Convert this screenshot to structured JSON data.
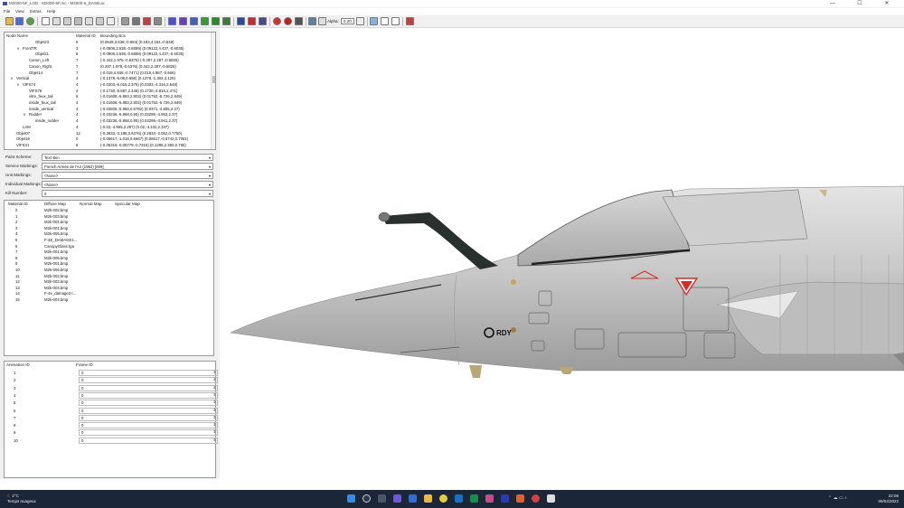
{
  "window": {
    "title": "M2000-5F_LOD - M2000-5F.mc - M2000-5_DASB.ac",
    "minimize": "—",
    "maximize": "☐",
    "close": "✕"
  },
  "menu": [
    "File",
    "View",
    "Extras",
    "Help"
  ],
  "toolbar": {
    "alpha_label": "Alpha:",
    "alpha_value": "0.20"
  },
  "node_tree": {
    "columns": [
      "Node Name",
      "Material ID",
      "Bounding Box"
    ],
    "rows": [
      {
        "indent": 4,
        "toggle": "",
        "name": "Objet23",
        "mat": "8",
        "bbox": "(0.0648,3.538,-0.684) (0.184,4.164,-0.648)"
      },
      {
        "indent": 2,
        "toggle": "v",
        "name": "FrontTR",
        "mat": "3",
        "bbox": "(-0.0906,3.538,-0.6889) (0.09122,4.437,-0.6035)"
      },
      {
        "indent": 4,
        "toggle": "",
        "name": "Objet21",
        "mat": "8",
        "bbox": "(-0.0906,3.538,-0.6889) (0.09122,4.437,-0.6035)"
      },
      {
        "indent": 3,
        "toggle": "",
        "name": "Canon_Left",
        "mat": "7",
        "bbox": "(-0.342,1.978,-0.6376) (-0.287,2.287,-0.5826)"
      },
      {
        "indent": 3,
        "toggle": "",
        "name": "Canon_Right",
        "mat": "7",
        "bbox": "(0.287,1.978,-0.6376) (0.342,2.287,-0.5826)"
      },
      {
        "indent": 3,
        "toggle": "",
        "name": "Objet14",
        "mat": "7",
        "bbox": "(-0.015,4.848,-0.7471) (0.015,4.987,-0.666)"
      },
      {
        "indent": 1,
        "toggle": "v",
        "name": "Vertical",
        "mat": "4",
        "bbox": "(-0.1378,-6.08,0.658) (0.1378,-1.302,3.129)"
      },
      {
        "indent": 2,
        "toggle": "v",
        "name": "VIFS74",
        "mat": "4",
        "bbox": "(-0.0303,-6.015,2.376) (0.0303,-4.316,2.548)"
      },
      {
        "indent": 3,
        "toggle": "",
        "name": "VIFS78",
        "mat": "4",
        "bbox": "(-0.1730,-5.587,2.448) (0.1730,-4.816,2.471)"
      },
      {
        "indent": 3,
        "toggle": "",
        "name": "vitre_feux_tail",
        "mat": "6",
        "bbox": "(-0.01608,-5.883,2.803) (0.01752,-5.726,2.849)"
      },
      {
        "indent": 3,
        "toggle": "",
        "name": "inside_feux_tail",
        "mat": "4",
        "bbox": "(-0.01608,-5.883,2.802) (0.01752,-5.726,2.849)"
      },
      {
        "indent": 3,
        "toggle": "",
        "name": "inside_vertical",
        "mat": "4",
        "bbox": "(-0.03505,-5.868,0.6782) (0.0371,-4.805,2.27)"
      },
      {
        "indent": 3,
        "toggle": "v",
        "name": "Rudder",
        "mat": "4",
        "bbox": "(-0.03236,-5.868,0.95) (0.03299,-4.953,2.37)"
      },
      {
        "indent": 4,
        "toggle": "",
        "name": "inside_rudder",
        "mat": "4",
        "bbox": "(-0.03236,-5.868,0.95) (0.03299,-4.941,2.37)"
      },
      {
        "indent": 2,
        "toggle": "",
        "name": "LAM",
        "mat": "4",
        "bbox": "(-0.02,-4.965,2.297) (0.02,-4.102,2.337)"
      },
      {
        "indent": 1,
        "toggle": "",
        "name": "Objet07",
        "mat": "12",
        "bbox": "(-0.2833,-3.188,0.6376) (0.2833,-3.062,0.7750)"
      },
      {
        "indent": 1,
        "toggle": "",
        "name": "Objet16",
        "mat": "0",
        "bbox": "(-0.06617,-1.018,0.6667) (0.06617,-0.5742,0.7081)"
      },
      {
        "indent": 1,
        "toggle": "",
        "name": "VIFS31",
        "mat": "6",
        "bbox": "(-0.05319,-0.05779,-0.7316) (0.1298,2.355,0.765)"
      }
    ]
  },
  "fields": [
    {
      "label": "Paint Scheme:",
      "value": "Text skin"
    },
    {
      "label": "Service Markings:",
      "value": "French Armée de l'Air (1962) [009]"
    },
    {
      "label": "Unit Markings:",
      "value": "<None>"
    },
    {
      "label": "Individual Markings:",
      "value": "<None>"
    },
    {
      "label": "Kill Number:",
      "value": "0"
    }
  ],
  "materials": {
    "columns": [
      "Material ID",
      "Diffuse Map",
      "Normal Map",
      "Specular Map"
    ],
    "rows": [
      {
        "id": "0",
        "diffuse": "M2k-002.bmp"
      },
      {
        "id": "1",
        "diffuse": "M2k-003.bmp"
      },
      {
        "id": "2",
        "diffuse": "M2k-001.bmp"
      },
      {
        "id": "3",
        "diffuse": "M2k-001.bmp"
      },
      {
        "id": "4",
        "diffuse": "M2k-005.bmp"
      },
      {
        "id": "5",
        "diffuse": "F-4E_DAMAGE1..."
      },
      {
        "id": "6",
        "diffuse": "CanopyGlass.tga"
      },
      {
        "id": "7",
        "diffuse": "M2k-001.bmp"
      },
      {
        "id": "8",
        "diffuse": "M2k-005.bmp"
      },
      {
        "id": "9",
        "diffuse": "M2k-001.bmp"
      },
      {
        "id": "10",
        "diffuse": "M2k-005.bmp"
      },
      {
        "id": "11",
        "diffuse": "M2k-002.bmp"
      },
      {
        "id": "12",
        "diffuse": "M2k-002.bmp"
      },
      {
        "id": "13",
        "diffuse": "M2k-004.bmp"
      },
      {
        "id": "14",
        "diffuse": "F-4e_damage2.t..."
      },
      {
        "id": "15",
        "diffuse": "M2k-004.bmp"
      }
    ]
  },
  "animations": {
    "columns": [
      "Animation ID",
      "Frame ID"
    ],
    "rows": [
      {
        "id": "1",
        "frame": "0"
      },
      {
        "id": "2",
        "frame": "0"
      },
      {
        "id": "3",
        "frame": "0"
      },
      {
        "id": "4",
        "frame": "0"
      },
      {
        "id": "5",
        "frame": "0"
      },
      {
        "id": "6",
        "frame": "0"
      },
      {
        "id": "7",
        "frame": "0"
      },
      {
        "id": "8",
        "frame": "0"
      },
      {
        "id": "9",
        "frame": "0"
      },
      {
        "id": "10",
        "frame": "0"
      }
    ]
  },
  "viewport": {
    "marking_text": "RDY"
  },
  "taskbar": {
    "temperature": "2°C",
    "weather": "Temps nuageux",
    "time": "22:08",
    "date": "09/04/2022"
  },
  "colors": {
    "aircraft_body": "#c9c9c9",
    "probe": "#2a302e",
    "roundel_red": "#d92a2a",
    "taskbar_bg": "#1b2638"
  }
}
